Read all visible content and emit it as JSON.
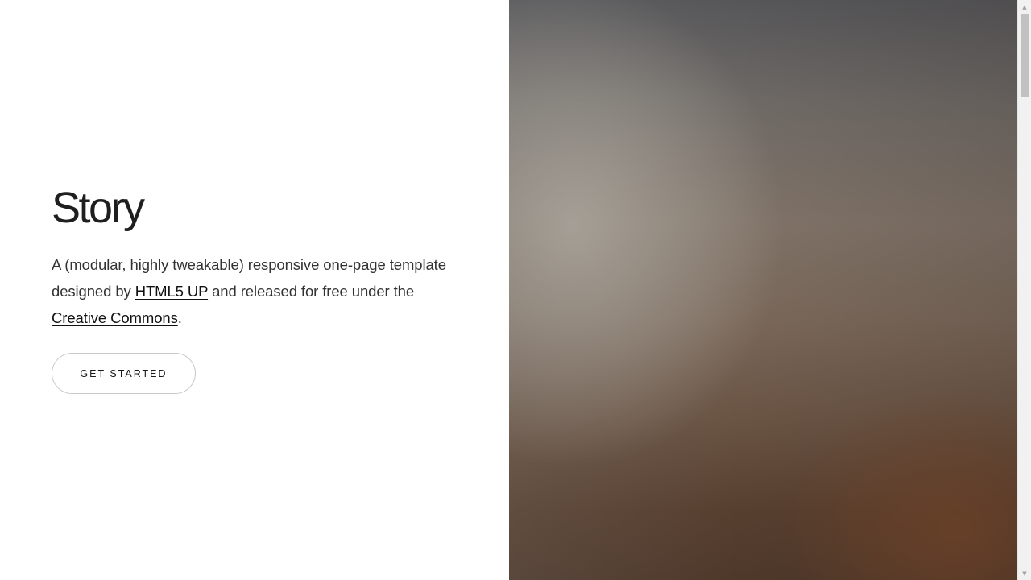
{
  "hero": {
    "title": "Story",
    "text_before_link1": "A (modular, highly tweakable) responsive one-page template designed by ",
    "link1": "HTML5 UP",
    "text_between_links": " and released for free under the ",
    "link2": "Creative Commons",
    "text_after_link2": ".",
    "button_label": "GET STARTED"
  },
  "scrollbar": {
    "up_icon": "▲",
    "down_icon": "▼"
  },
  "colors": {
    "accent_text": "#1f1f1f",
    "image_top": "#565659",
    "image_bottom": "#4e382a"
  }
}
